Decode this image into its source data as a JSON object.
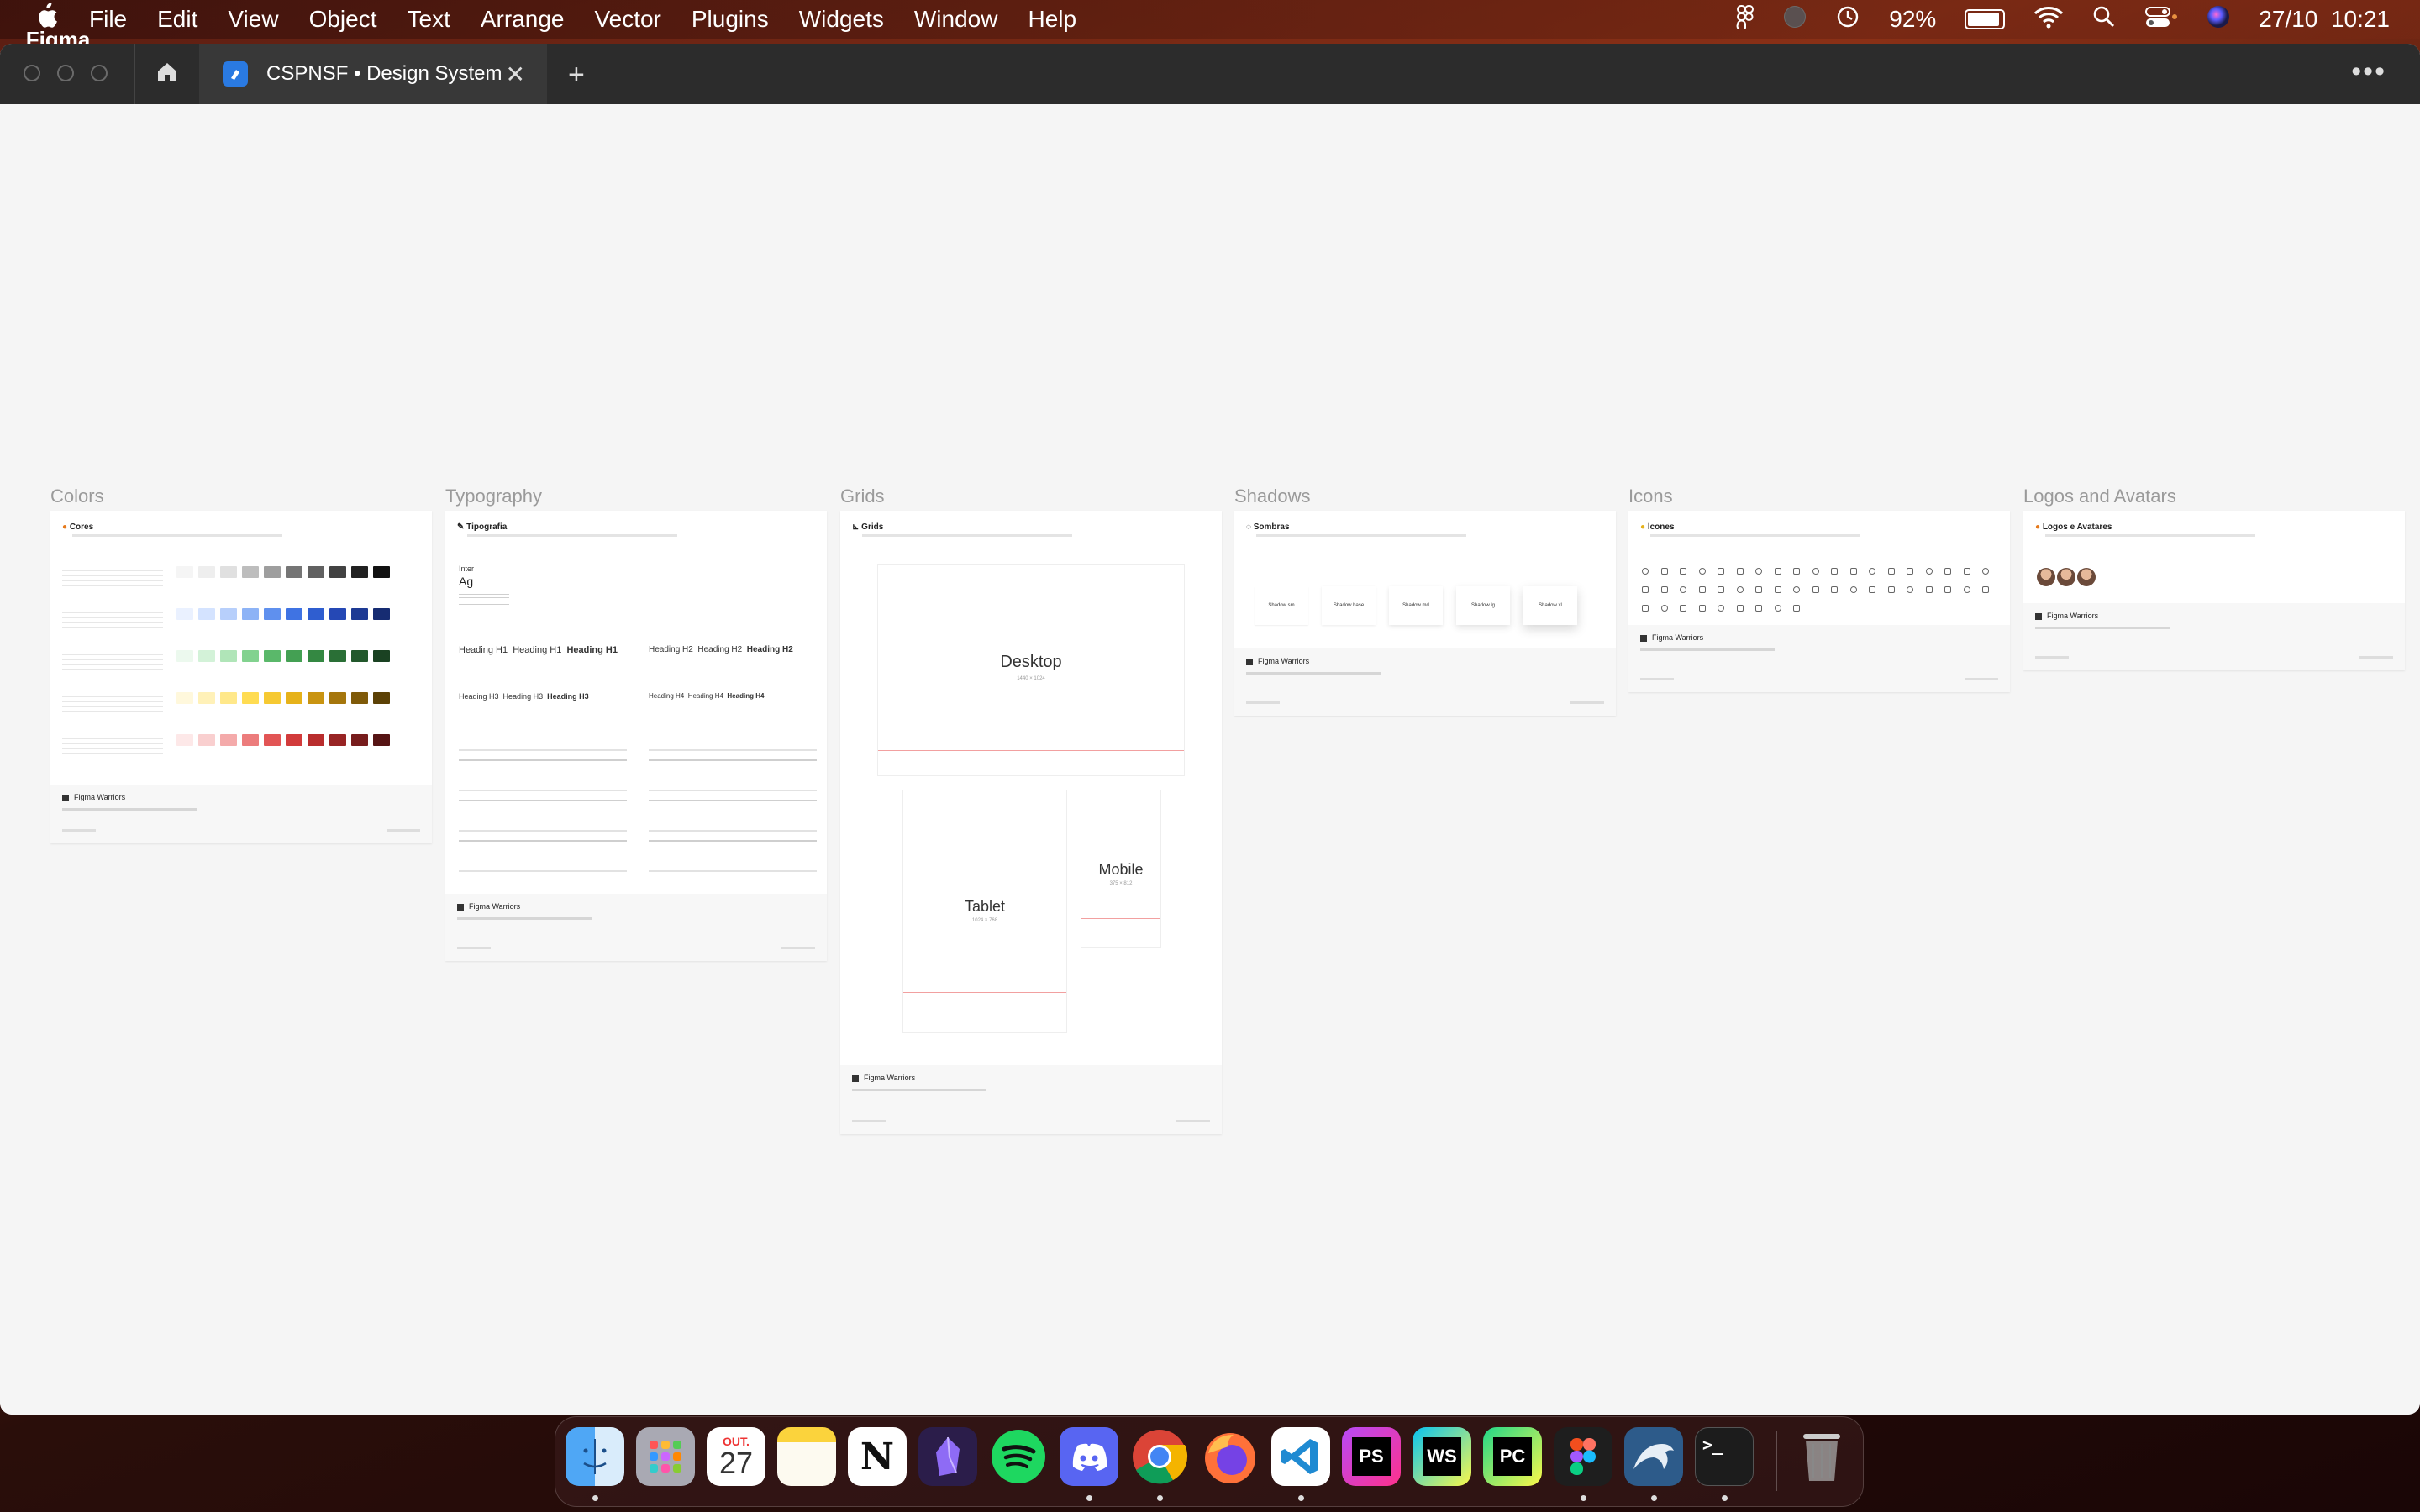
{
  "menubar": {
    "app_name": "Figma",
    "items": [
      "File",
      "Edit",
      "View",
      "Object",
      "Text",
      "Arrange",
      "Vector",
      "Plugins",
      "Widgets",
      "Window",
      "Help"
    ],
    "battery": "92%",
    "date_time": "27/10  10:21",
    "battery_level": 0.92
  },
  "tabs": {
    "active_title": "CSPNSF • Design System"
  },
  "frames": {
    "colors": {
      "label": "Colors",
      "header": "Cores"
    },
    "typography": {
      "label": "Typography",
      "header": "Tipografia",
      "font": "Inter",
      "sample": "Ag",
      "h1": "Heading H1",
      "h2": "Heading H2",
      "h3": "Heading H3",
      "h4": "Heading H4"
    },
    "grids": {
      "label": "Grids",
      "header": "Grids",
      "desktop": "Desktop",
      "desktop_size": "1440 × 1024",
      "tablet": "Tablet",
      "tablet_size": "1024 × 768",
      "mobile": "Mobile",
      "mobile_size": "375 × 812"
    },
    "shadows": {
      "label": "Shadows",
      "header": "Sombras",
      "cards": [
        "Shadow sm",
        "Shadow base",
        "Shadow md",
        "Shadow lg",
        "Shadow xl"
      ]
    },
    "icons": {
      "label": "Icons",
      "header": "Ícones"
    },
    "logos": {
      "label": "Logos and Avatars",
      "header": "Logos e Avatares"
    },
    "footer_brand": "Figma Warriors"
  },
  "palette": {
    "gray": [
      "#f5f5f5",
      "#eeeeee",
      "#e0e0e0",
      "#bdbdbd",
      "#9e9e9e",
      "#757575",
      "#616161",
      "#424242",
      "#212121",
      "#111111"
    ],
    "blue": [
      "#eaf1ff",
      "#d4e3ff",
      "#b7cffb",
      "#8db3f6",
      "#5f90ee",
      "#3f73e3",
      "#2f5ed0",
      "#2548b5",
      "#1d3a94",
      "#162c72"
    ],
    "green": [
      "#ecf9ee",
      "#d3f2d8",
      "#b0e5b8",
      "#82d28f",
      "#5ab86a",
      "#44a053",
      "#348842",
      "#2a6f36",
      "#22582c",
      "#1a4222"
    ],
    "yellow": [
      "#fff8dc",
      "#fff1b8",
      "#ffe88a",
      "#ffdc52",
      "#f6c932",
      "#e6b21a",
      "#c99411",
      "#a5760c",
      "#7f5a09",
      "#5c4106"
    ],
    "red": [
      "#fde8e8",
      "#f9cfcf",
      "#f4aaaa",
      "#ec7c7c",
      "#e25555",
      "#d23b3b",
      "#b92d2d",
      "#982424",
      "#771c1c",
      "#561414"
    ]
  },
  "dock": {
    "apps": [
      "finder",
      "launchpad",
      "calendar",
      "notes",
      "notion",
      "obsidian",
      "spotify",
      "discord",
      "chrome",
      "firefox",
      "vscode",
      "phpstorm",
      "webstorm",
      "pycharm",
      "figma",
      "mysql-workbench",
      "terminal",
      "trash"
    ],
    "calendar_month": "OUT.",
    "calendar_day": "27",
    "notion_glyph": "N",
    "phpstorm_glyph": "PS",
    "webstorm_glyph": "WS",
    "pycharm_glyph": "PC",
    "terminal_glyph": ">_"
  }
}
